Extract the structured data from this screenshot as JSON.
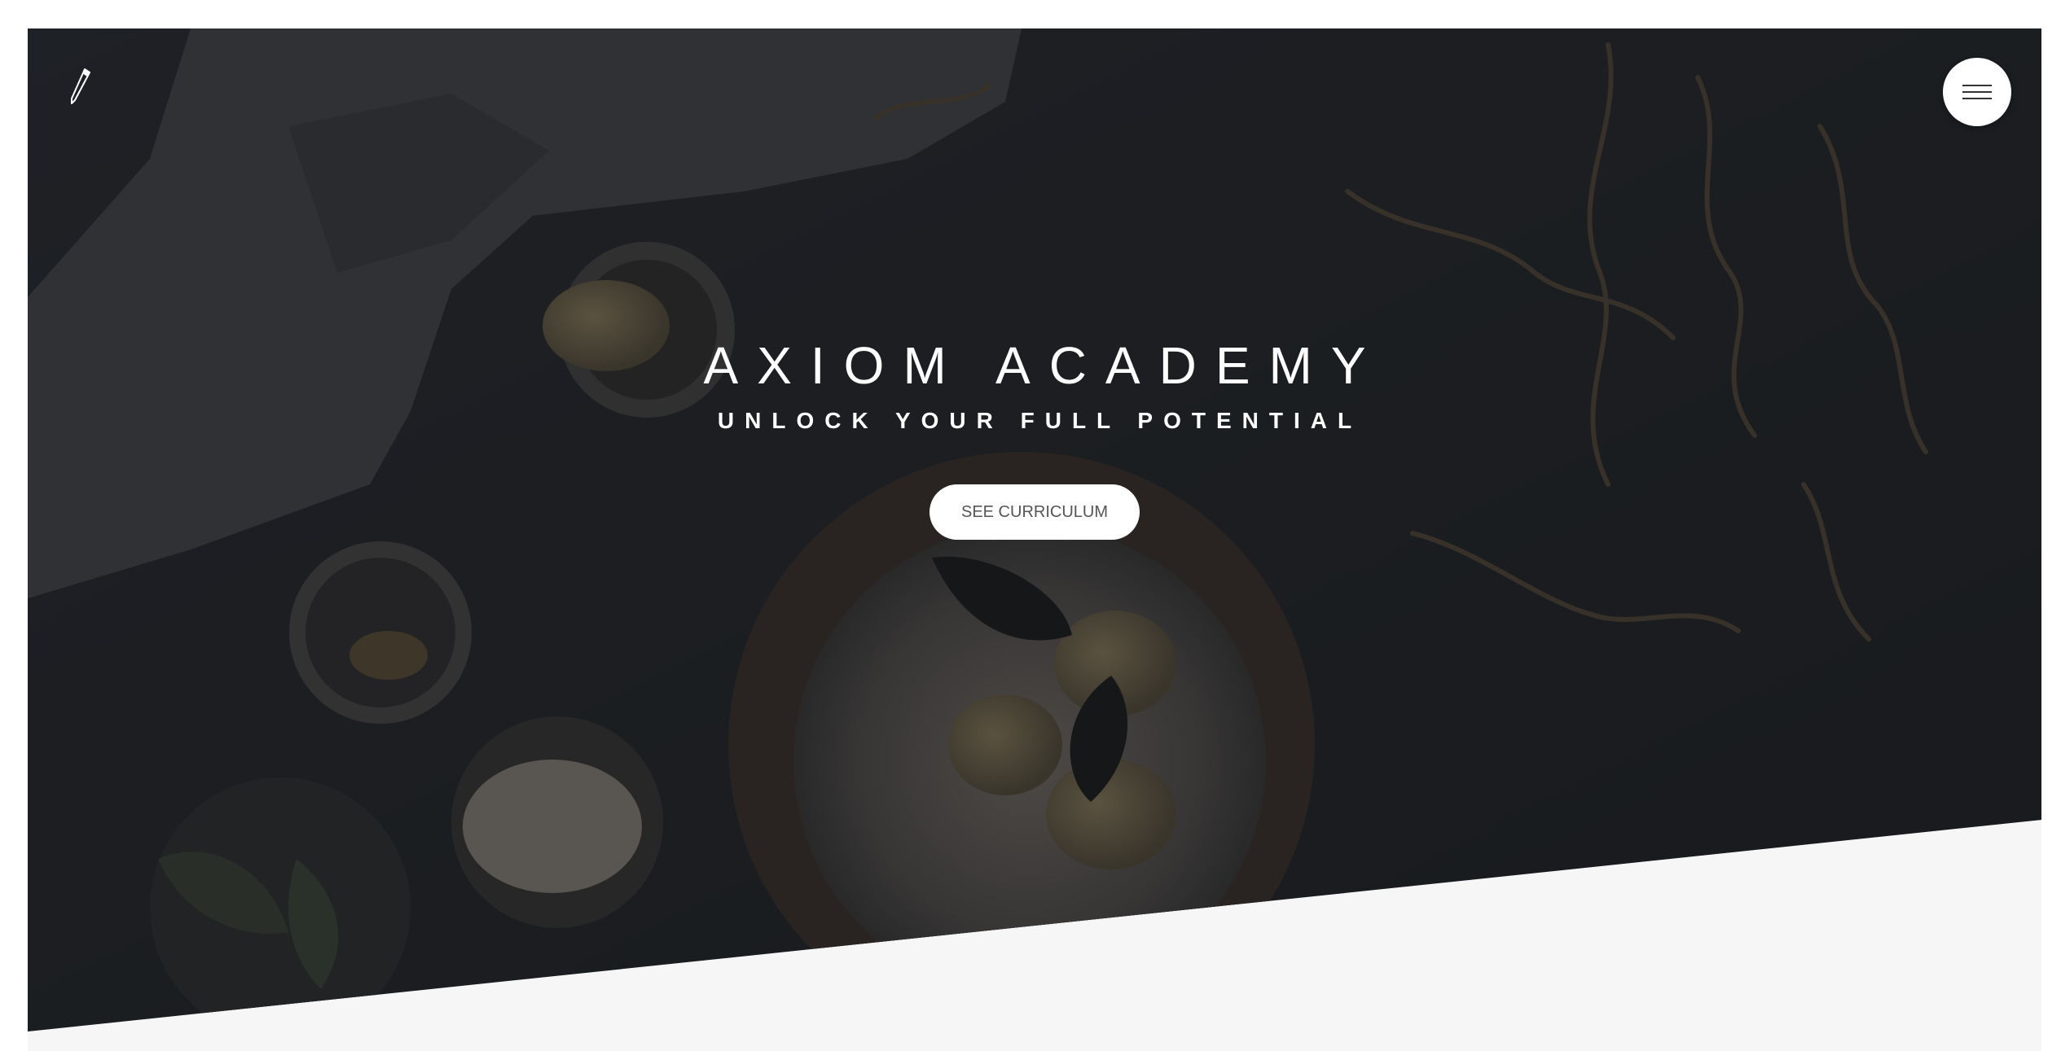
{
  "site": {
    "logo_icon": "pen-nib-icon",
    "menu_icon": "hamburger-menu-icon"
  },
  "hero": {
    "title": "AXIOM ACADEMY",
    "subtitle": "UNLOCK YOUR FULL POTENTIAL",
    "cta_label": "SEE CURRICULUM"
  },
  "colors": {
    "overlay": "#1b1d21",
    "section_background": "#f6f6f6",
    "button_background": "#ffffff",
    "button_text": "#555555",
    "hero_text": "#ffffff"
  }
}
